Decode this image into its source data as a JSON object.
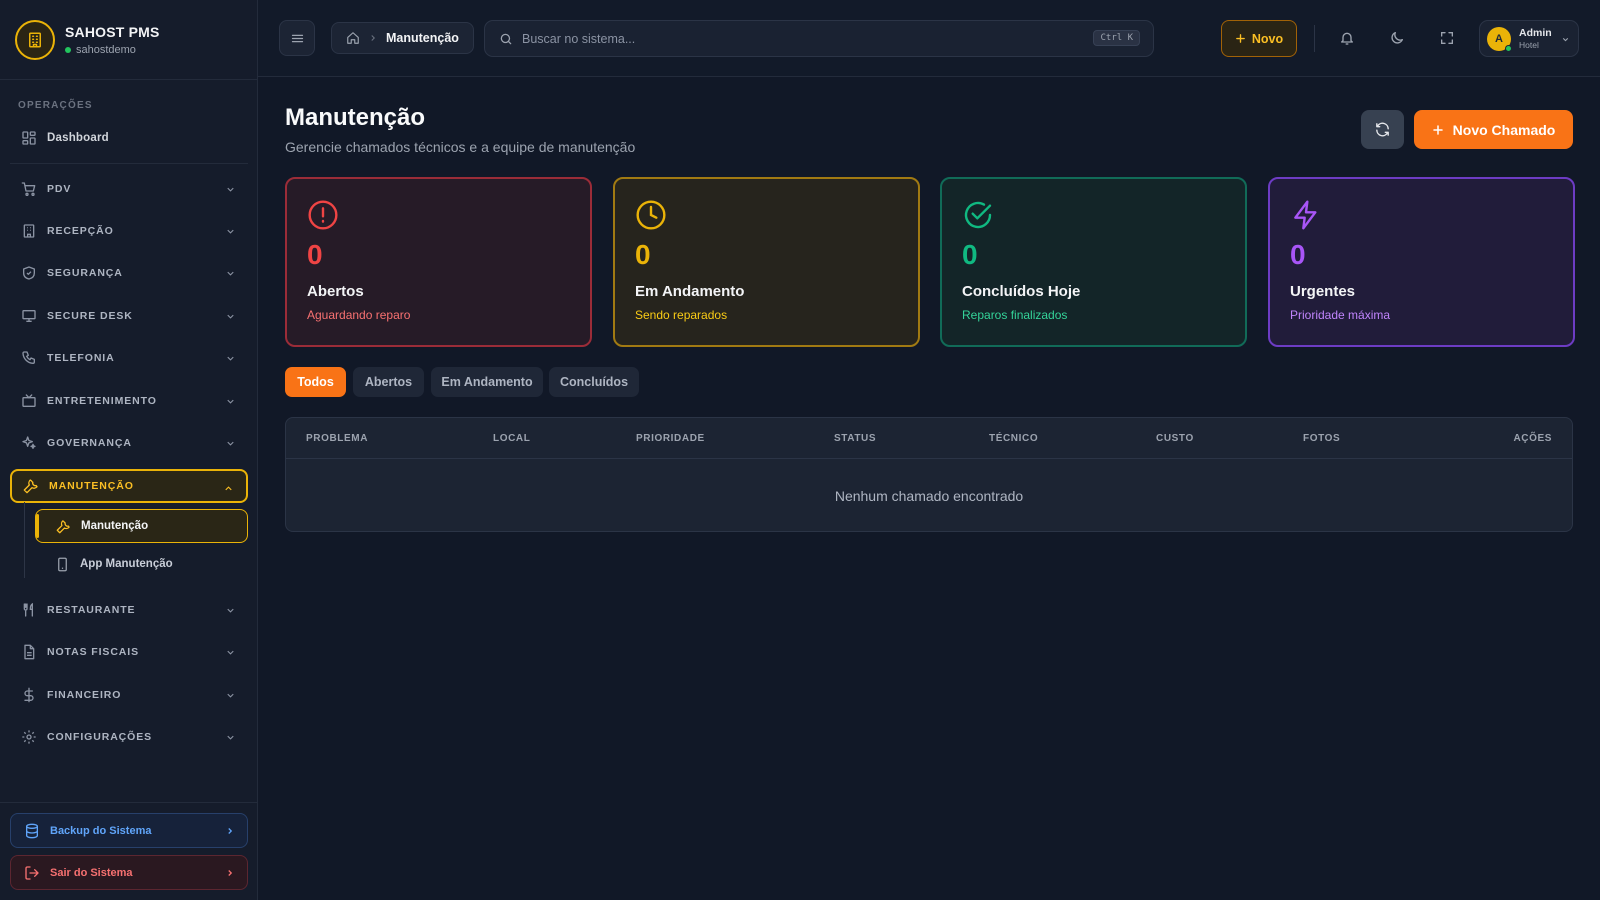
{
  "brand": {
    "name": "SAHOST PMS",
    "subtitle": "sahostdemo"
  },
  "sidebar": {
    "section_label": "OPERAÇÕES",
    "dashboard": "Dashboard",
    "items": [
      {
        "label": "PDV",
        "icon": "cart-icon"
      },
      {
        "label": "RECEPÇÃO",
        "icon": "building-icon"
      },
      {
        "label": "SEGURANÇA",
        "icon": "shield-icon"
      },
      {
        "label": "SECURE DESK",
        "icon": "monitor-icon"
      },
      {
        "label": "TELEFONIA",
        "icon": "phone-icon"
      },
      {
        "label": "ENTRETENIMENTO",
        "icon": "tv-icon"
      },
      {
        "label": "GOVERNANÇA",
        "icon": "sparkles-icon"
      },
      {
        "label": "MANUTENÇÃO",
        "icon": "wrench-icon"
      },
      {
        "label": "RESTAURANTE",
        "icon": "utensils-icon"
      },
      {
        "label": "NOTAS FISCAIS",
        "icon": "file-icon"
      },
      {
        "label": "FINANCEIRO",
        "icon": "dollar-icon"
      },
      {
        "label": "CONFIGURAÇÕES",
        "icon": "gear-icon"
      }
    ],
    "subitems": [
      {
        "label": "Manutenção",
        "icon": "wrench-icon"
      },
      {
        "label": "App Manutenção",
        "icon": "smartphone-icon"
      }
    ],
    "backup": "Backup do Sistema",
    "logout": "Sair do Sistema"
  },
  "topbar": {
    "breadcrumb_current": "Manutenção",
    "search_placeholder": "Buscar no sistema...",
    "search_shortcut": "Ctrl K",
    "new_button": "Novo",
    "user_name": "Admin",
    "user_role": "Hotel",
    "user_initial": "A"
  },
  "page": {
    "title": "Manutenção",
    "subtitle": "Gerencie chamados técnicos e a equipe de manutenção",
    "new_ticket": "Novo Chamado"
  },
  "stats": [
    {
      "value": "0",
      "title": "Abertos",
      "subtitle": "Aguardando reparo",
      "color": "#ef4444",
      "icon": "alert-circle-icon"
    },
    {
      "value": "0",
      "title": "Em Andamento",
      "subtitle": "Sendo reparados",
      "color": "#eab308",
      "icon": "clock-icon"
    },
    {
      "value": "0",
      "title": "Concluídos Hoje",
      "subtitle": "Reparos finalizados",
      "color": "#10b981",
      "icon": "check-circle-icon"
    },
    {
      "value": "0",
      "title": "Urgentes",
      "subtitle": "Prioridade máxima",
      "color": "#a855f7",
      "icon": "lightning-icon"
    }
  ],
  "tabs": [
    "Todos",
    "Abertos",
    "Em Andamento",
    "Concluídos"
  ],
  "table": {
    "columns": [
      "PROBLEMA",
      "LOCAL",
      "PRIORIDADE",
      "STATUS",
      "TÉCNICO",
      "CUSTO",
      "FOTOS",
      "AÇÕES"
    ],
    "empty_message": "Nenhum chamado encontrado"
  },
  "colors": {
    "accent": "#f97316",
    "active_nav": "#eab308",
    "background": "#111827"
  }
}
